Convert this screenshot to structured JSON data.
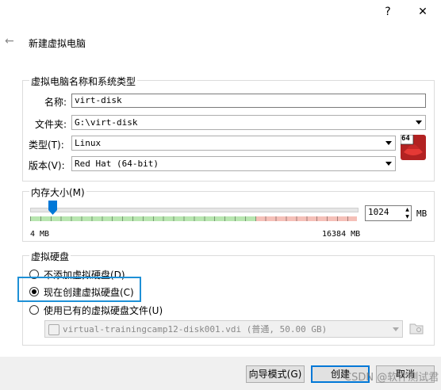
{
  "window": {
    "help_glyph": "?",
    "close_glyph": "✕",
    "back_glyph": "←"
  },
  "wizard": {
    "title": "新建虚拟电脑"
  },
  "name_group": {
    "legend": "虚拟电脑名称和系统类型",
    "name_label": "名称:",
    "name_value": "virt-disk",
    "folder_label": "文件夹:",
    "folder_value": "G:\\virt-disk",
    "type_label": "类型(T):",
    "type_value": "Linux",
    "version_label": "版本(V):",
    "version_value": "Red Hat (64-bit)",
    "os_badge": "64"
  },
  "memory": {
    "legend": "内存大小(M)",
    "value": "1024",
    "unit": "MB",
    "min_label": "4 MB",
    "max_label": "16384 MB",
    "slider_fraction": 0.0623
  },
  "disk": {
    "legend": "虚拟硬盘",
    "options": [
      {
        "label": "不添加虚拟硬盘(D)",
        "checked": false
      },
      {
        "label": "现在创建虚拟硬盘(C)",
        "checked": true
      },
      {
        "label": "使用已有的虚拟硬盘文件(U)",
        "checked": false
      }
    ],
    "existing_file": "virtual-trainingcamp12-disk001.vdi (普通, 50.00 GB)"
  },
  "buttons": {
    "guided": "向导模式(G)",
    "create": "创建",
    "cancel": "取消"
  },
  "watermark": "CSDN @软件测试君",
  "colors": {
    "highlight": "#1e90d6",
    "slider_green": "#b8e6b0",
    "slider_red": "#f5c0b8",
    "accent": "#0078d7"
  }
}
